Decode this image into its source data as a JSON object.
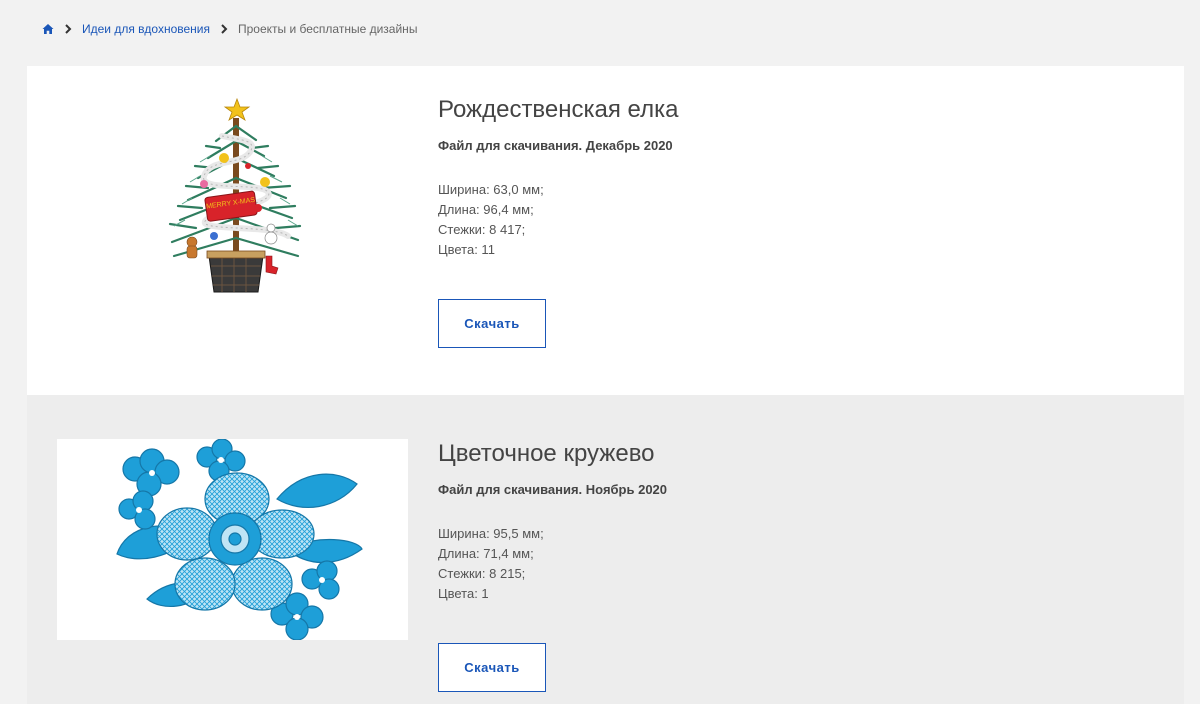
{
  "breadcrumb": {
    "home_icon": "home-icon",
    "separator_icon": "chevron-right-icon",
    "link_label": "Идеи для вдохновения",
    "current_label": "Проекты и бесплатные дизайны"
  },
  "colors": {
    "link": "#1a56b8",
    "card_white": "#ffffff",
    "card_grey": "#ededed",
    "page_bg": "#f2f2f2",
    "lace_blue": "#1e9fd8"
  },
  "designs": [
    {
      "title": "Рождественская елка",
      "subtitle": "Файл для скачивания. Декабрь 2020",
      "width": "Ширина: 63,0 мм;",
      "length": "Длина: 96,4 мм;",
      "stitches": "Стежки: 8 417;",
      "colors": "Цвета: 11",
      "button_label": "Скачать",
      "image_text": "MERRY X-MAS",
      "image": "christmas-tree-embroidery"
    },
    {
      "title": "Цветочное кружево",
      "subtitle": "Файл для скачивания. Ноябрь 2020",
      "width": "Ширина: 95,5 мм;",
      "length": "Длина: 71,4 мм;",
      "stitches": "Стежки: 8 215;",
      "colors": "Цвета: 1",
      "button_label": "Скачать",
      "image": "floral-lace-embroidery"
    }
  ]
}
